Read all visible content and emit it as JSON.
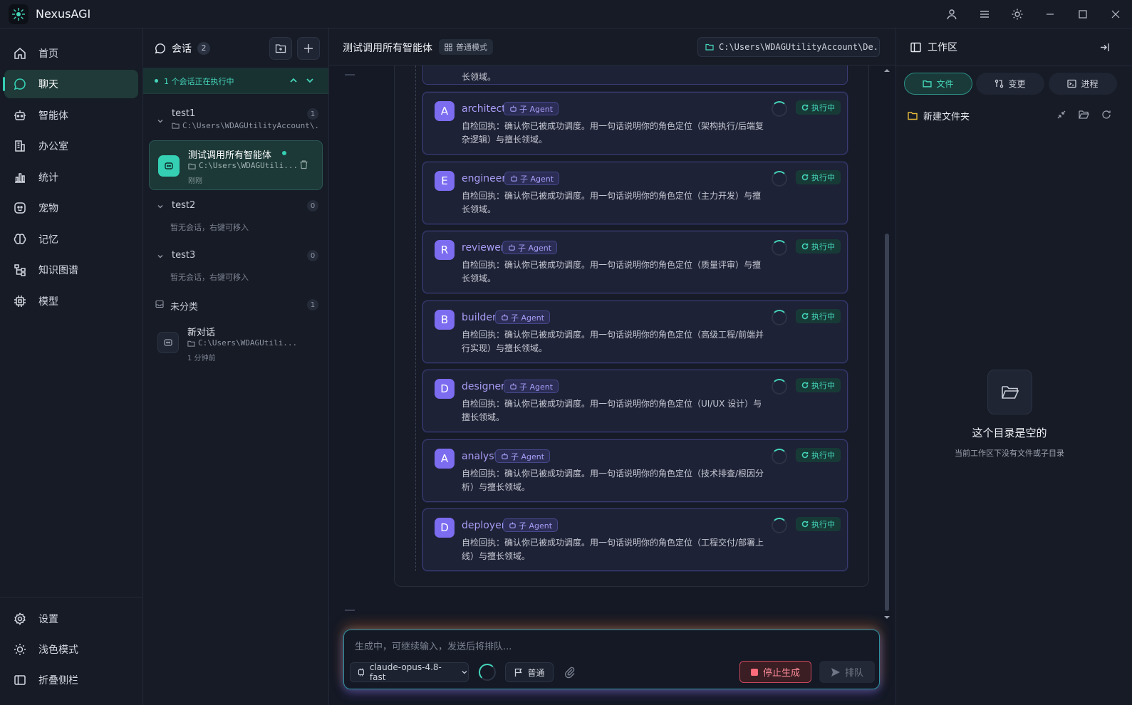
{
  "app": {
    "title": "NexusAGI"
  },
  "nav": {
    "items": [
      {
        "label": "首页",
        "icon": "home-icon"
      },
      {
        "label": "聊天",
        "icon": "chat-icon",
        "active": true
      },
      {
        "label": "智能体",
        "icon": "robot-icon"
      },
      {
        "label": "办公室",
        "icon": "building-icon"
      },
      {
        "label": "统计",
        "icon": "bar-chart-icon"
      },
      {
        "label": "宠物",
        "icon": "pet-icon"
      },
      {
        "label": "记忆",
        "icon": "brain-icon"
      },
      {
        "label": "知识图谱",
        "icon": "knowledge-graph-icon"
      },
      {
        "label": "模型",
        "icon": "chip-icon"
      }
    ],
    "bottom": [
      {
        "label": "设置",
        "icon": "gear-icon"
      },
      {
        "label": "浅色模式",
        "icon": "sun-icon"
      },
      {
        "label": "折叠侧栏",
        "icon": "sidebar-collapse-icon"
      }
    ]
  },
  "sessions": {
    "title": "会话",
    "count": "2",
    "running_text": "1 个会话正在执行中",
    "groups": [
      {
        "name": "test1",
        "count": "1",
        "path": "C:\\Users\\WDAGUtilityAccount\\..."
      },
      {
        "name": "test2",
        "count": "0",
        "empty": "暂无会话，右键可移入"
      },
      {
        "name": "test3",
        "count": "0",
        "empty": "暂无会话，右键可移入"
      },
      {
        "name": "未分类",
        "count": "1"
      }
    ],
    "active": {
      "title": "测试调用所有智能体",
      "path": "C:\\Users\\WDAGUtili...",
      "time": "刚刚"
    },
    "other": {
      "title": "新对话",
      "path": "C:\\Users\\WDAGUtili...",
      "time": "1 分钟前"
    }
  },
  "chat": {
    "title": "测试调用所有智能体",
    "mode": "普通模式",
    "path": "C:\\Users\\WDAGUtilityAccount\\De...",
    "top_fragment": "长领域。",
    "agents": [
      {
        "initial": "A",
        "name": "architect",
        "tag": "子 Agent",
        "status": "执行中",
        "desc": "自检回执：确认你已被成功调度。用一句话说明你的角色定位（架构执行/后端复杂逻辑）与擅长领域。"
      },
      {
        "initial": "E",
        "name": "engineer",
        "tag": "子 Agent",
        "status": "执行中",
        "desc": "自检回执：确认你已被成功调度。用一句话说明你的角色定位（主力开发）与擅长领域。"
      },
      {
        "initial": "R",
        "name": "reviewer",
        "tag": "子 Agent",
        "status": "执行中",
        "desc": "自检回执：确认你已被成功调度。用一句话说明你的角色定位（质量评审）与擅长领域。"
      },
      {
        "initial": "B",
        "name": "builder",
        "tag": "子 Agent",
        "status": "执行中",
        "desc": "自检回执：确认你已被成功调度。用一句话说明你的角色定位（高级工程/前端并行实现）与擅长领域。"
      },
      {
        "initial": "D",
        "name": "designer",
        "tag": "子 Agent",
        "status": "执行中",
        "desc": "自检回执：确认你已被成功调度。用一句话说明你的角色定位（UI/UX 设计）与擅长领域。"
      },
      {
        "initial": "A",
        "name": "analyst",
        "tag": "子 Agent",
        "status": "执行中",
        "desc": "自检回执：确认你已被成功调度。用一句话说明你的角色定位（技术排查/根因分析）与擅长领域。"
      },
      {
        "initial": "D",
        "name": "deployer",
        "tag": "子 Agent",
        "status": "执行中",
        "desc": "自检回执：确认你已被成功调度。用一句话说明你的角色定位（工程交付/部署上线）与擅长领域。"
      }
    ]
  },
  "composer": {
    "placeholder": "生成中，可继续输入，发送后将排队...",
    "model": "claude-opus-4.8-fast",
    "mode": "普通",
    "stop": "停止生成",
    "queue": "排队"
  },
  "workspace": {
    "title": "工作区",
    "tabs": [
      "文件",
      "变更",
      "进程"
    ],
    "folder": "新建文件夹",
    "empty_title": "这个目录是空的",
    "empty_sub": "当前工作区下没有文件或子目录"
  },
  "colors": {
    "accent": "#35d0b4",
    "agent": "#7c6cf0",
    "danger": "#c7475a"
  }
}
